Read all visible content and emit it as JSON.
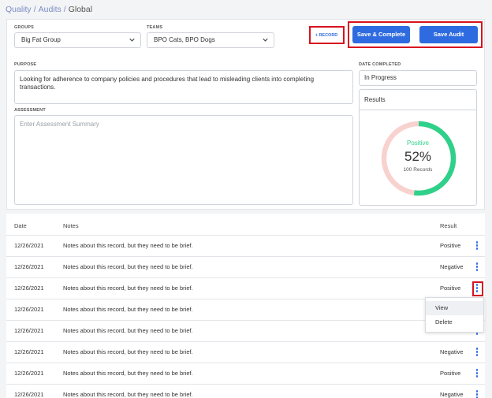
{
  "breadcrumb": {
    "part1": "Quality",
    "part2": "Audits",
    "current": "Global",
    "separator": "/"
  },
  "groups": {
    "label": "GROUPS",
    "value": "Big Fat Group"
  },
  "teams": {
    "label": "TEAMS",
    "value": "BPO Cats, BPO Dogs"
  },
  "actions": {
    "record": "+ RECORD",
    "save_complete": "Save & Complete",
    "save_audit": "Save Audit"
  },
  "purpose": {
    "label": "PURPOSE",
    "text": "Looking for adherence to company policies and procedures that lead to misleading clients into completing transactions."
  },
  "assessment": {
    "label": "ASSESSMENT",
    "placeholder": "Enter Assessment Summary"
  },
  "date_completed": {
    "label": "DATE COMPLETED",
    "value": "In Progress"
  },
  "results": {
    "title": "Results",
    "status": "Positive",
    "percent_label": "52%",
    "percent": 0.52,
    "records": "100 Records",
    "positive_color": "#2fd18a",
    "negative_color": "#f8d2cf"
  },
  "table": {
    "headers": {
      "date": "Date",
      "notes": "Notes",
      "result": "Result"
    },
    "rows": [
      {
        "date": "12/26/2021",
        "notes": "Notes about this record, but they need to be brief.",
        "result": "Positive"
      },
      {
        "date": "12/26/2021",
        "notes": "Notes about this record, but they need to be brief.",
        "result": "Negative"
      },
      {
        "date": "12/26/2021",
        "notes": "Notes about this record, but they need to be brief.",
        "result": "Positive"
      },
      {
        "date": "12/26/2021",
        "notes": "Notes about this record, but they need to be brief.",
        "result": ""
      },
      {
        "date": "12/26/2021",
        "notes": "Notes about this record, but they need to be brief.",
        "result": ""
      },
      {
        "date": "12/26/2021",
        "notes": "Notes about this record, but they need to be brief.",
        "result": "Negative"
      },
      {
        "date": "12/26/2021",
        "notes": "Notes about this record, but they need to be brief.",
        "result": "Positive"
      },
      {
        "date": "12/26/2021",
        "notes": "Notes about this record, but they need to be brief.",
        "result": "Negative"
      }
    ]
  },
  "row_menu": {
    "view": "View",
    "delete": "Delete"
  }
}
